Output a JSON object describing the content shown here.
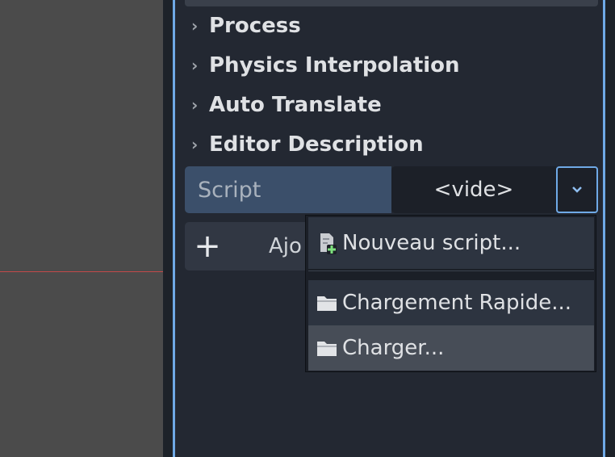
{
  "sections": [
    {
      "label": "Process"
    },
    {
      "label": "Physics Interpolation"
    },
    {
      "label": "Auto Translate"
    },
    {
      "label": "Editor Description"
    }
  ],
  "script": {
    "label": "Script",
    "value": "<vide>"
  },
  "add_component": {
    "label": "Ajo"
  },
  "menu": {
    "items": [
      {
        "label": "Nouveau script...",
        "icon": "new-script-icon"
      },
      {
        "label": "Chargement Rapide...",
        "icon": "folder-icon"
      },
      {
        "label": "Charger...",
        "icon": "folder-icon"
      }
    ]
  },
  "colors": {
    "accent": "#6fa9e6",
    "property_label_bg": "#3b4f6a",
    "panel_bg": "#232832"
  }
}
